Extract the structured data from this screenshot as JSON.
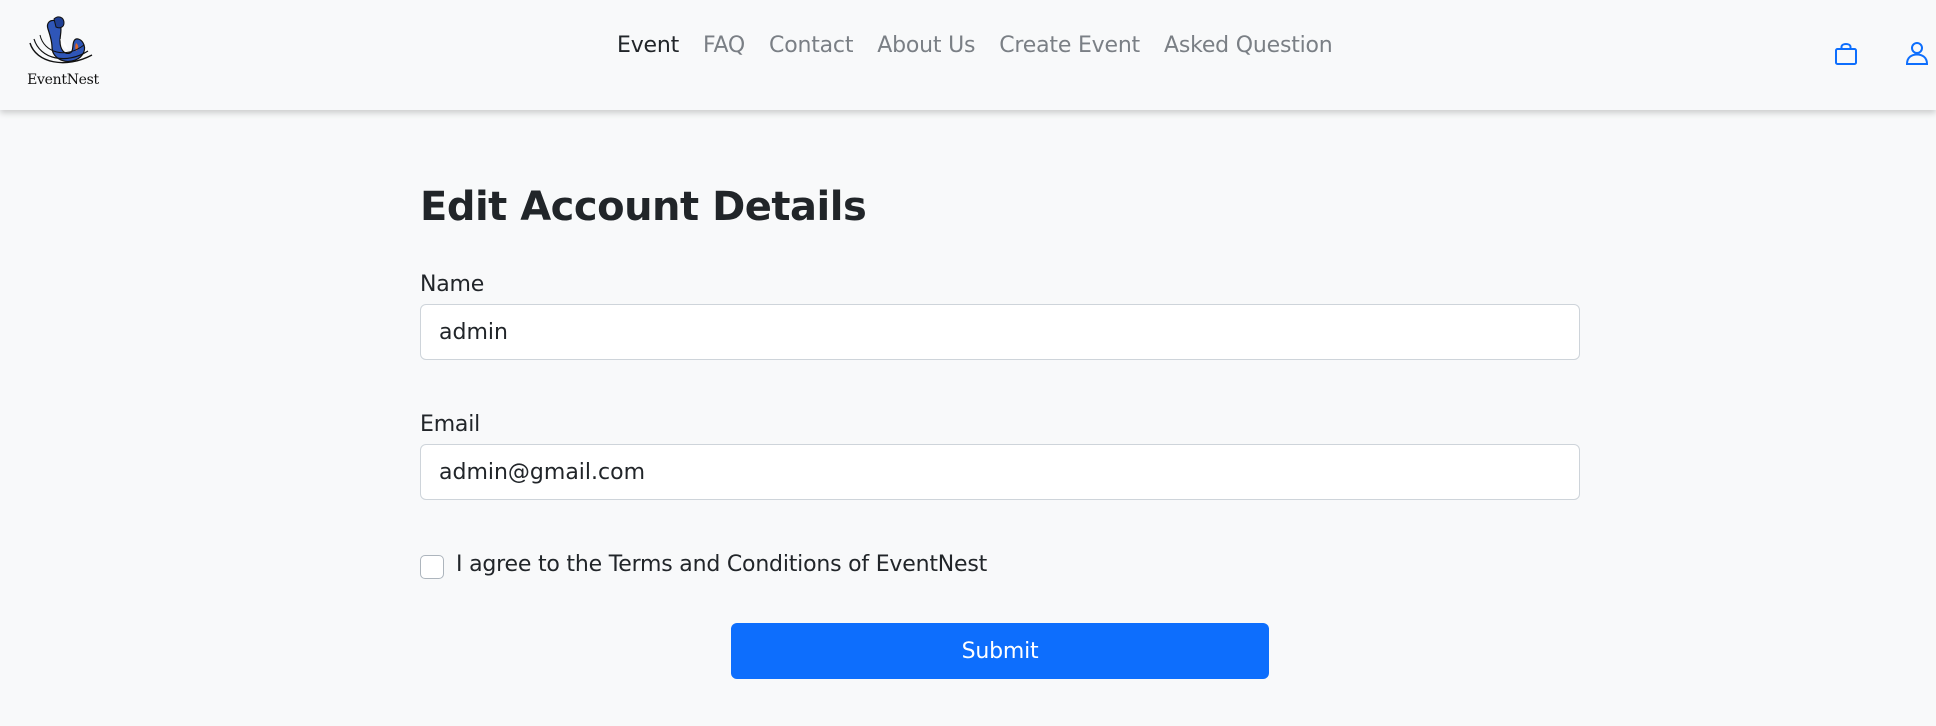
{
  "brand": {
    "name": "EventNest",
    "logo_icon": "bird-logo"
  },
  "nav": {
    "items": [
      {
        "label": "Event",
        "active": true
      },
      {
        "label": "FAQ",
        "active": false
      },
      {
        "label": "Contact",
        "active": false
      },
      {
        "label": "About Us",
        "active": false
      },
      {
        "label": "Create Event",
        "active": false
      },
      {
        "label": "Asked Question",
        "active": false
      }
    ],
    "icons": [
      "shopping-bag-icon",
      "user-icon"
    ]
  },
  "form": {
    "title": "Edit Account Details",
    "name_label": "Name",
    "name_value": "admin",
    "email_label": "Email",
    "email_value": "admin@gmail.com",
    "terms_label": "I agree to the Terms and Conditions of EventNest",
    "terms_checked": false,
    "submit_label": "Submit"
  },
  "colors": {
    "accent": "#0d6efd",
    "background": "#f8f9fa"
  }
}
